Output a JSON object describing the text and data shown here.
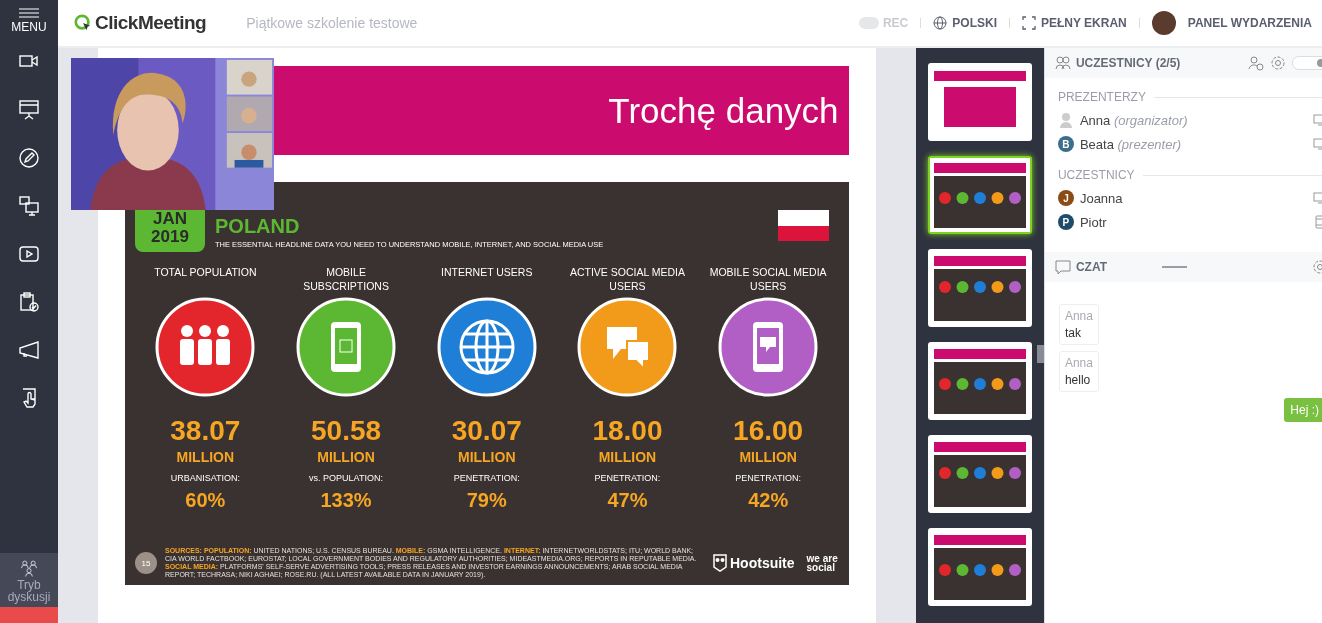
{
  "sidebar": {
    "menu_label": "MENU",
    "tools": [
      {
        "kind": "camera"
      },
      {
        "kind": "presentation"
      },
      {
        "kind": "pencil"
      },
      {
        "kind": "screens"
      },
      {
        "kind": "video"
      },
      {
        "kind": "clipboard"
      },
      {
        "kind": "megaphone"
      },
      {
        "kind": "hand"
      }
    ],
    "mode_button": "Tryb dyskusji"
  },
  "topbar": {
    "logo": "ClickMeeting",
    "event_title": "Piątkowe szkolenie testowe",
    "rec": {
      "label": "REC",
      "on": false
    },
    "language": "POLSKI",
    "fullscreen": "PEŁNY EKRAN",
    "panel": "PANEL WYDARZENIA"
  },
  "slide": {
    "title": "Trochę danych",
    "infographic": {
      "month": "JAN",
      "year": "2019",
      "country": "POLAND",
      "subtitle": "THE ESSENTIAL HEADLINE DATA YOU NEED TO UNDERSTAND MOBILE, INTERNET, AND SOCIAL MEDIA USE",
      "stats": [
        {
          "label": "TOTAL POPULATION",
          "kind": "people",
          "color": "#e3262c",
          "value": "38.07",
          "unit": "MILLION",
          "sublabel": "URBANISATION:",
          "percent": "60%"
        },
        {
          "label": "MOBILE SUBSCRIPTIONS",
          "kind": "phone",
          "color": "#5cb833",
          "value": "50.58",
          "unit": "MILLION",
          "sublabel": "vs. POPULATION:",
          "percent": "133%"
        },
        {
          "label": "INTERNET USERS",
          "kind": "globe",
          "color": "#1f7fd6",
          "value": "30.07",
          "unit": "MILLION",
          "sublabel": "PENETRATION:",
          "percent": "79%"
        },
        {
          "label": "ACTIVE SOCIAL MEDIA USERS",
          "kind": "chat",
          "color": "#f29a1a",
          "value": "18.00",
          "unit": "MILLION",
          "sublabel": "PENETRATION:",
          "percent": "47%"
        },
        {
          "label": "MOBILE SOCIAL MEDIA USERS",
          "kind": "phonechat",
          "color": "#b15fc4",
          "value": "16.00",
          "unit": "MILLION",
          "sublabel": "PENETRATION:",
          "percent": "42%"
        }
      ],
      "page": "15",
      "sources": "**SOURCES: POPULATION:** UNITED NATIONS; U.S. CENSUS BUREAU. **MOBILE:** GSMA INTELLIGENCE. **INTERNET:** INTERNETWORLDSTATS; ITU; WORLD BANK; CIA WORLD FACTBOOK; EUROSTAT; LOCAL GOVERNMENT BODIES AND REGULATORY AUTHORITIES; MIDEASTMEDIA.ORG; REPORTS IN REPUTABLE MEDIA. **SOCIAL MEDIA:** PLATFORMS' SELF-SERVE ADVERTISING TOOLS; PRESS RELEASES AND INVESTOR EARNINGS ANNOUNCEMENTS; ARAB SOCIAL MEDIA REPORT; TECHRASA; NIKI AGHAEI; ROSE.RU. (ALL LATEST AVAILABLE DATA IN JANUARY 2019).",
      "brand": "Hootsuite",
      "brand2": "we are social"
    }
  },
  "thumbnails": [
    {
      "kind": "title",
      "selected": false
    },
    {
      "kind": "stats",
      "selected": true
    },
    {
      "kind": "stats",
      "selected": false
    },
    {
      "kind": "stats",
      "selected": false
    },
    {
      "kind": "stats",
      "selected": false
    },
    {
      "kind": "stats",
      "selected": false
    }
  ],
  "participants": {
    "title": "UCZESTNICY (2/5)",
    "groups": [
      {
        "heading": "PREZENTERZY",
        "people": [
          {
            "name": "Anna",
            "role": "(organizator)",
            "kind": "monitor"
          },
          {
            "name": "Beata",
            "role": "(prezenter)",
            "initial": "B",
            "color": "#3d6f8c",
            "kind": "monitor"
          }
        ]
      },
      {
        "heading": "UCZESTNICY",
        "people": [
          {
            "name": "Joanna",
            "initial": "J",
            "color": "#8a4b14",
            "kind": "monitor"
          },
          {
            "name": "Piotr",
            "initial": "P",
            "color": "#1e4d6b",
            "kind": "phone"
          }
        ]
      }
    ],
    "toggle": {
      "on": true
    }
  },
  "chat": {
    "title": "CZAT",
    "messages": [
      {
        "author": "Anna",
        "text": "tak",
        "own": false
      },
      {
        "author": "Anna",
        "text": "hello",
        "own": false
      },
      {
        "text": "Hej :)",
        "own": true
      }
    ]
  }
}
